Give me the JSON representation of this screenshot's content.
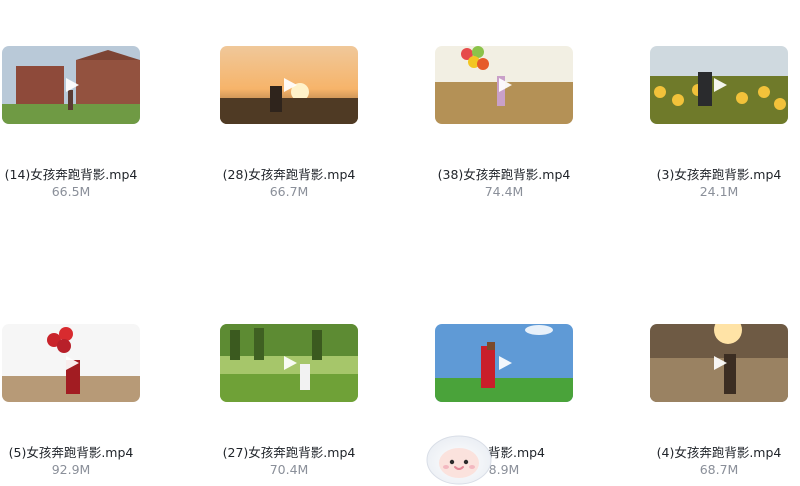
{
  "files": [
    {
      "name": "(14)女孩奔跑背影.mp4",
      "size": "66.5M"
    },
    {
      "name": "(28)女孩奔跑背影.mp4",
      "size": "66.7M"
    },
    {
      "name": "(38)女孩奔跑背影.mp4",
      "size": "74.4M"
    },
    {
      "name": "(3)女孩奔跑背影.mp4",
      "size": "24.1M"
    },
    {
      "name": "(5)女孩奔跑背影.mp4",
      "size": "92.9M"
    },
    {
      "name": "(27)女孩奔跑背影.mp4",
      "size": "70.4M"
    },
    {
      "name": "奔跑背影.mp4",
      "size": "8.9M"
    },
    {
      "name": "(4)女孩奔跑背影.mp4",
      "size": "68.7M"
    }
  ],
  "icons": {
    "play": "play-icon",
    "mascot": "mascot-icon"
  }
}
